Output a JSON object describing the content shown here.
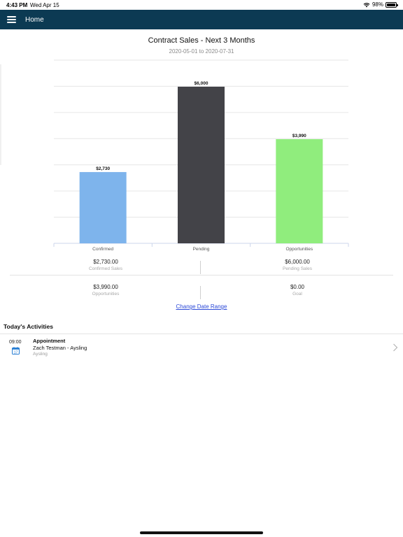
{
  "status": {
    "time": "4:43 PM",
    "date": "Wed Apr 15",
    "battery": "98%",
    "battery_level": 0.98
  },
  "nav": {
    "title": "Home",
    "menu_icon": "hamburger-menu-icon"
  },
  "chart": {
    "title": "Contract Sales - Next 3 Months",
    "subtitle": "2020-05-01 to 2020-07-31"
  },
  "chart_data": {
    "type": "bar",
    "categories": [
      "Confirmed",
      "Pending",
      "Opportunities"
    ],
    "values": [
      2730,
      6000,
      3990
    ],
    "data_labels": [
      "$2,730",
      "$6,000",
      "$3,990"
    ],
    "colors": [
      "#7eb4ec",
      "#434348",
      "#90ed7d"
    ],
    "ylim": [
      0,
      6000
    ],
    "grid": true,
    "legend": "none"
  },
  "summary": {
    "confirmed_value": "$2,730.00",
    "confirmed_label": "Confirmed Sales",
    "pending_value": "$6,000.00",
    "pending_label": "Pending Sales",
    "opportunities_value": "$3,990.00",
    "opportunities_label": "Opportunities",
    "goal_value": "$0.00",
    "goal_label": "Goal"
  },
  "change_date_label": "Change Date Range",
  "activities": {
    "title": "Today's Activities",
    "items": [
      {
        "time": "09:00",
        "calendar_day": "17",
        "icon": "calendar-icon",
        "type": "Appointment",
        "person": "Zach Testman - Aysling",
        "company": "Aysling"
      }
    ]
  }
}
